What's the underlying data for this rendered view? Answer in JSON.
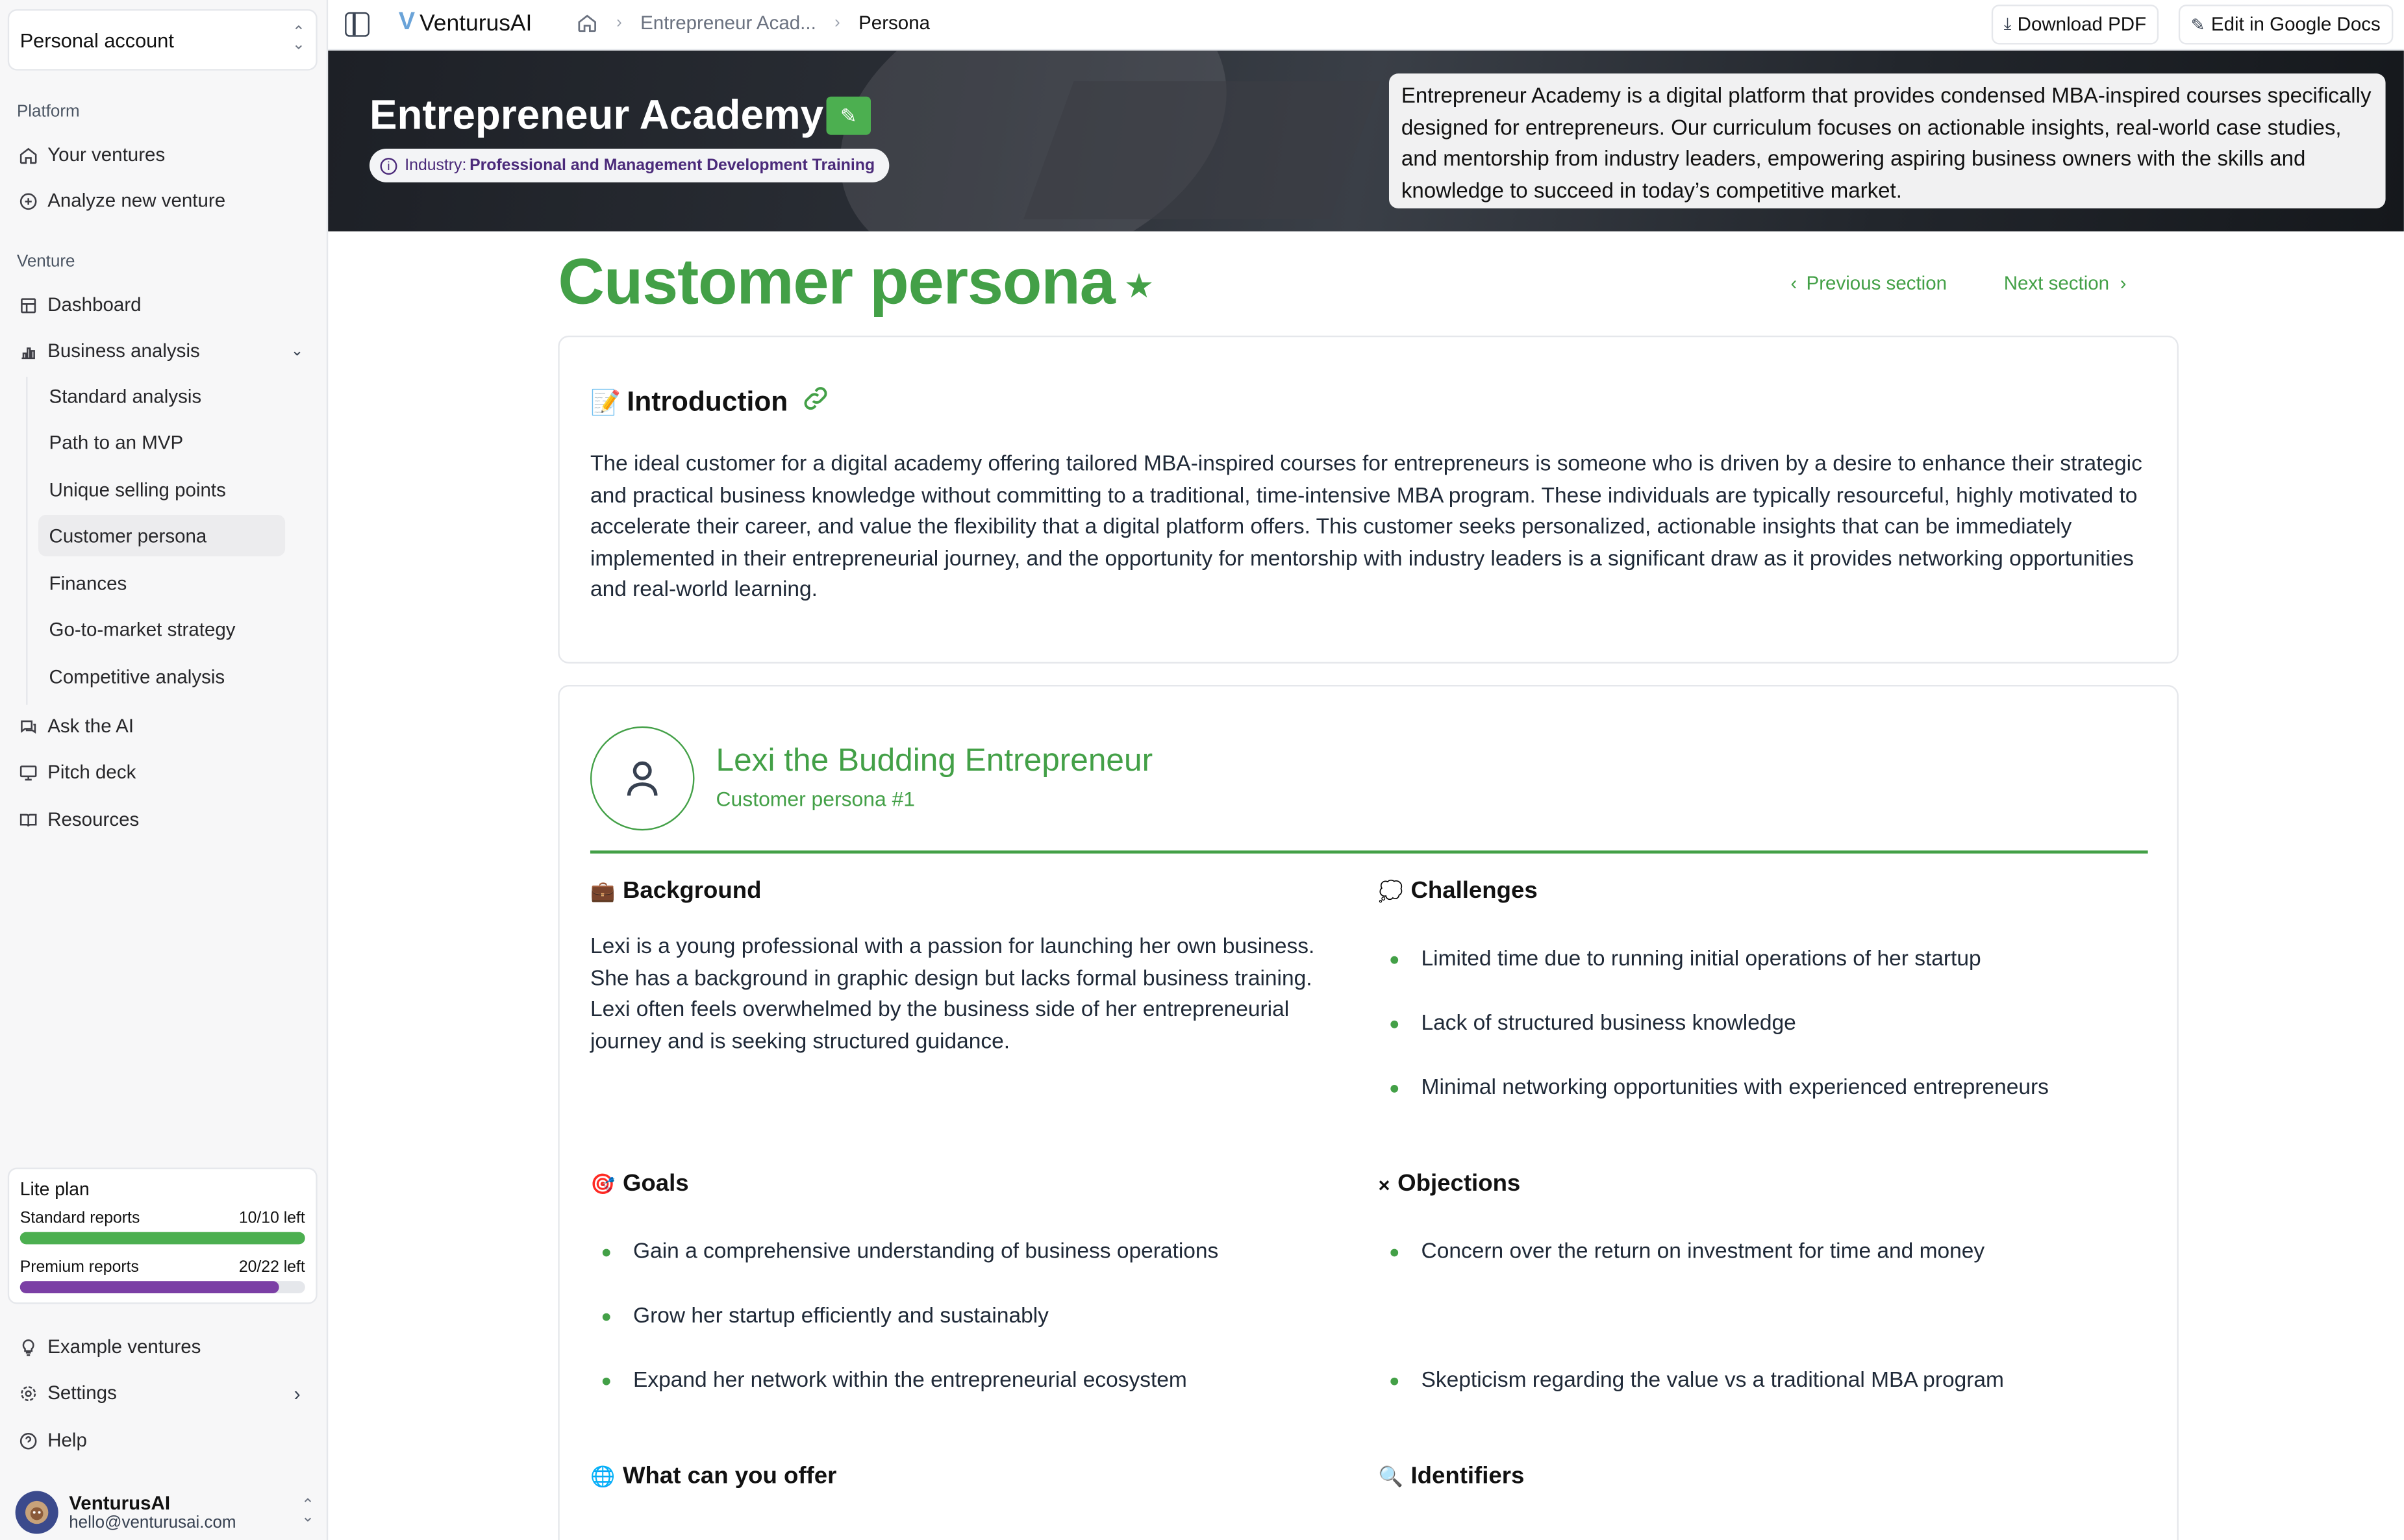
{
  "sidebar": {
    "account": "Personal account",
    "platform_label": "Platform",
    "platform_items": [
      {
        "label": "Your ventures",
        "icon": "home-icon"
      },
      {
        "label": "Analyze new venture",
        "icon": "plus-circle-icon"
      }
    ],
    "venture_label": "Venture",
    "venture_items": [
      {
        "label": "Dashboard",
        "icon": "dashboard-icon"
      },
      {
        "label": "Business analysis",
        "icon": "chart-icon"
      }
    ],
    "analysis_subitems": [
      {
        "label": "Standard analysis"
      },
      {
        "label": "Path to an MVP"
      },
      {
        "label": "Unique selling points"
      },
      {
        "label": "Customer persona"
      },
      {
        "label": "Finances"
      },
      {
        "label": "Go-to-market strategy"
      },
      {
        "label": "Competitive analysis"
      }
    ],
    "more_items": [
      {
        "label": "Ask the AI",
        "icon": "chat-icon"
      },
      {
        "label": "Pitch deck",
        "icon": "presentation-icon"
      },
      {
        "label": "Resources",
        "icon": "book-icon"
      }
    ],
    "plan": {
      "title": "Lite plan",
      "standard_label": "Standard reports",
      "standard_value": "10/10 left",
      "standard_fraction": 1.0,
      "standard_color": "#4caf50",
      "premium_label": "Premium reports",
      "premium_value": "20/22 left",
      "premium_fraction": 0.909,
      "premium_color": "#7b3fa5"
    },
    "footer_items": [
      {
        "label": "Example ventures",
        "icon": "bulb-icon"
      },
      {
        "label": "Settings",
        "icon": "gear-icon"
      },
      {
        "label": "Help",
        "icon": "help-icon"
      }
    ],
    "user": {
      "name": "VenturusAI",
      "email": "hello@venturusai.com"
    }
  },
  "topbar": {
    "brand": "VenturusAI",
    "breadcrumb": [
      "Entrepreneur Acad...",
      "Persona"
    ],
    "download_pdf": "Download PDF",
    "edit_google_docs": "Edit in Google Docs"
  },
  "banner": {
    "title": "Entrepreneur Academy",
    "industry_label": "Industry:",
    "industry_value": "Professional and Management Development Training",
    "description": "Entrepreneur Academy is a digital platform that provides condensed MBA-inspired courses specifically designed for entrepreneurs. Our curriculum focuses on actionable insights, real-world case studies, and mentorship from industry leaders, empowering aspiring business owners with the skills and knowledge to succeed in today’s competitive market."
  },
  "page": {
    "title": "Customer persona",
    "prev": "Previous section",
    "next": "Next section",
    "accent": "#43a047"
  },
  "intro": {
    "emoji": "📝",
    "heading": "Introduction",
    "text": "The ideal customer for a digital academy offering tailored MBA-inspired courses for entrepreneurs is someone who is driven by a desire to enhance their strategic and practical business knowledge without committing to a traditional, time-intensive MBA program. These individuals are typically resourceful, highly motivated to accelerate their career, and value the flexibility that a digital platform offers. This customer seeks personalized, actionable insights that can be immediately implemented in their entrepreneurial journey, and the opportunity for mentorship with industry leaders is a significant draw as it provides networking opportunities and real-world learning."
  },
  "persona": {
    "name": "Lexi the Budding Entrepreneur",
    "subtitle": "Customer persona #1",
    "background": {
      "emoji": "💼",
      "heading": "Background",
      "text": "Lexi is a young professional with a passion for launching her own business. She has a background in graphic design but lacks formal business training. Lexi often feels overwhelmed by the business side of her entrepreneurial journey and is seeking structured guidance."
    },
    "challenges": {
      "emoji": "💭",
      "heading": "Challenges",
      "items": [
        "Limited time due to running initial operations of her startup",
        "Lack of structured business knowledge",
        "Minimal networking opportunities with experienced entrepreneurs"
      ]
    },
    "goals": {
      "emoji": "🎯",
      "heading": "Goals",
      "items": [
        "Gain a comprehensive understanding of business operations",
        "Grow her startup efficiently and sustainably",
        "Expand her network within the entrepreneurial ecosystem"
      ]
    },
    "objections": {
      "emoji": "×",
      "heading": "Objections",
      "items": [
        "Concern over the return on investment for time and money",
        "Skepticism regarding the value vs a traditional MBA program"
      ]
    },
    "offer": {
      "emoji": "🌐",
      "heading": "What can you offer"
    },
    "identifiers": {
      "emoji": "🔍",
      "heading": "Identifiers"
    }
  }
}
